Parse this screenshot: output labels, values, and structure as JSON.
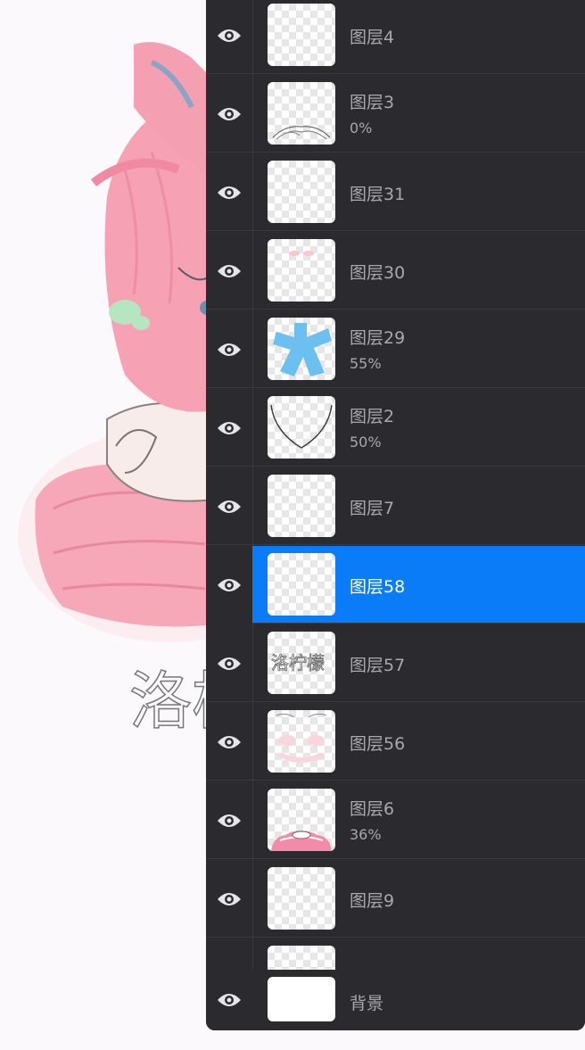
{
  "colors": {
    "panel_bg": "#2b2a2e",
    "active_row": "#0a7cf7",
    "label_text": "#a9a8ad",
    "active_label_text": "#ffffff"
  },
  "canvas": {
    "watermark_text": "洛柠檬"
  },
  "layers": [
    {
      "name": "图层4",
      "opacity": "",
      "visible_icon": "eye-icon",
      "thumb": "empty"
    },
    {
      "name": "图层3",
      "opacity": "0%",
      "visible_icon": "eye-icon",
      "thumb": "sketch-lines"
    },
    {
      "name": "图层31",
      "opacity": "",
      "visible_icon": "eye-icon",
      "thumb": "empty"
    },
    {
      "name": "图层30",
      "opacity": "",
      "visible_icon": "eye-icon",
      "thumb": "pink-dots"
    },
    {
      "name": "图层29",
      "opacity": "55%",
      "visible_icon": "eye-icon",
      "thumb": "blue-shape"
    },
    {
      "name": "图层2",
      "opacity": "50%",
      "visible_icon": "eye-icon",
      "thumb": "face-outline"
    },
    {
      "name": "图层7",
      "opacity": "",
      "visible_icon": "eye-icon",
      "thumb": "empty"
    },
    {
      "name": "图层58",
      "opacity": "",
      "visible_icon": "eye-icon",
      "thumb": "empty",
      "active": true
    },
    {
      "name": "图层57",
      "opacity": "",
      "visible_icon": "eye-icon",
      "thumb": "signature"
    },
    {
      "name": "图层56",
      "opacity": "",
      "visible_icon": "eye-icon",
      "thumb": "pink-blush"
    },
    {
      "name": "图层6",
      "opacity": "36%",
      "visible_icon": "eye-icon",
      "thumb": "pink-fur"
    },
    {
      "name": "图层9",
      "opacity": "",
      "visible_icon": "eye-icon",
      "thumb": "empty"
    }
  ],
  "background_layer": {
    "name": "背景"
  }
}
